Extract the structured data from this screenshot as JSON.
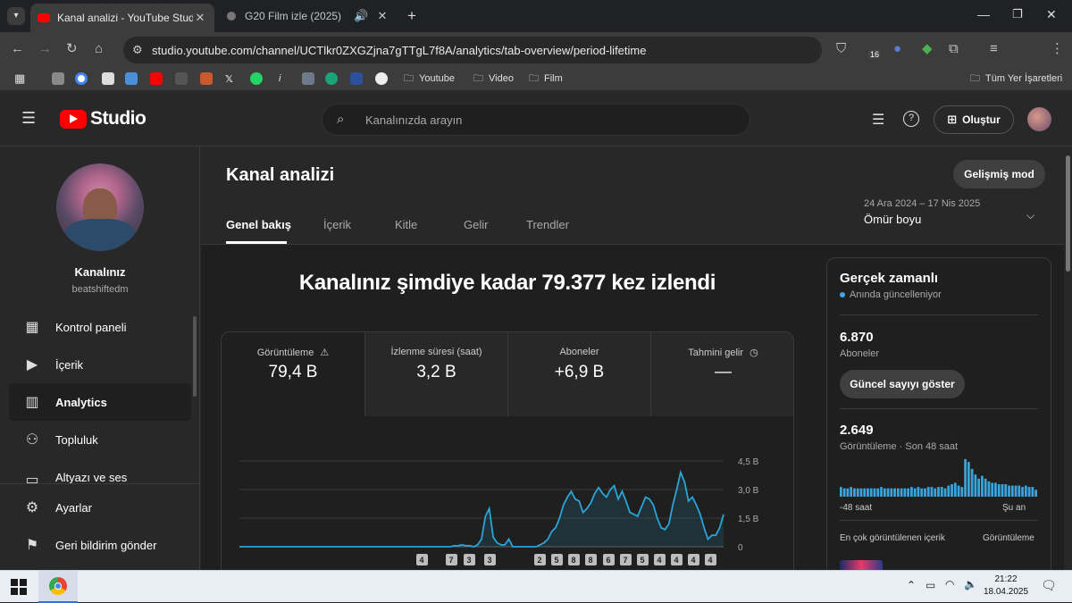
{
  "browser": {
    "tabs": [
      {
        "title": "Kanal analizi - YouTube Studio"
      },
      {
        "title": "G20 Film izle (2025)"
      }
    ],
    "url": "studio.youtube.com/channel/UCTlkr0ZXGZjna7gTTgL7f8A/analytics/tab-overview/period-lifetime",
    "bookmarks": [
      "Youtube",
      "Video",
      "Film"
    ],
    "all_bookmarks": "Tüm Yer İşaretleri",
    "extension_badge": "16"
  },
  "header": {
    "logo": "Studio",
    "search_placeholder": "Kanalınızda arayın",
    "create_label": "Oluştur"
  },
  "sidebar": {
    "channel_name": "Kanalınız",
    "channel_handle": "beatshiftedm",
    "items": [
      {
        "label": "Kontrol paneli",
        "icon": "dashboard-icon"
      },
      {
        "label": "İçerik",
        "icon": "content-icon"
      },
      {
        "label": "Analytics",
        "icon": "analytics-icon"
      },
      {
        "label": "Topluluk",
        "icon": "community-icon"
      },
      {
        "label": "Altyazı ve ses",
        "icon": "subtitles-icon"
      }
    ],
    "settings_label": "Ayarlar",
    "feedback_label": "Geri bildirim gönder"
  },
  "main": {
    "title": "Kanal analizi",
    "advanced_mode": "Gelişmiş mod",
    "tabs": [
      "Genel bakış",
      "İçerik",
      "Kitle",
      "Gelir",
      "Trendler"
    ],
    "date_range": "24 Ara 2024 – 17 Nis 2025",
    "period": "Ömür boyu",
    "headline": "Kanalınız şimdiye kadar 79.377 kez izlendi",
    "stats": [
      {
        "label": "Görüntüleme",
        "value": "79,4 B"
      },
      {
        "label": "İzlenme süresi (saat)",
        "value": "3,2 B"
      },
      {
        "label": "Aboneler",
        "value": "+6,9 B"
      },
      {
        "label": "Tahmini gelir",
        "value": "—"
      }
    ],
    "video_markers": [
      "4",
      "7",
      "3",
      "3",
      "2",
      "5",
      "8",
      "8",
      "6",
      "7",
      "5",
      "4",
      "4",
      "4",
      "4"
    ]
  },
  "chart_data": {
    "type": "area",
    "series": [
      {
        "values": [
          0,
          0,
          0,
          0,
          0,
          0,
          0,
          0,
          0,
          0,
          0,
          0,
          0,
          0,
          0,
          0,
          0,
          0,
          0,
          0,
          0,
          0,
          0,
          0,
          0,
          0,
          0,
          0,
          0,
          0,
          0,
          0,
          0,
          0,
          0,
          0,
          0,
          0,
          0,
          0,
          0,
          0,
          0,
          0,
          0,
          0,
          0,
          0,
          0,
          0,
          0,
          0,
          0,
          0,
          0,
          0.05,
          0.05,
          0.1,
          0.05,
          0.05,
          0,
          0.1,
          0.4,
          1.6,
          2.0,
          0.5,
          0.2,
          0.1,
          0.1,
          0.4,
          0,
          0,
          0,
          0,
          0,
          0,
          0,
          0.1,
          0.2,
          0.4,
          0.8,
          1.0,
          1.5,
          2.2,
          2.6,
          2.9,
          2.5,
          2.4,
          1.8,
          2.0,
          2.3,
          2.8,
          3.1,
          2.8,
          2.6,
          3.0,
          3.2,
          2.5,
          2.9,
          2.4,
          1.8,
          1.7,
          1.6,
          2.1,
          2.6,
          2.5,
          2.2,
          1.5,
          1.0,
          0.9,
          1.2,
          2.2,
          3.0,
          3.9,
          3.4,
          2.4,
          2.6,
          2.2,
          1.7,
          1.0,
          0.4,
          0.6,
          0.6,
          1.0,
          1.7
        ]
      }
    ],
    "y_ticks": [
      "4,5 B",
      "3,0 B",
      "1,5 B",
      "0"
    ],
    "ylim": [
      0,
      4.5
    ],
    "grid": true
  },
  "realtime": {
    "title": "Gerçek zamanlı",
    "subtitle": "Anında güncelleniyor",
    "subs_value": "6.870",
    "subs_label": "Aboneler",
    "show_count_btn": "Güncel sayıyı göster",
    "views_value": "2.649",
    "views_label": "Görüntüleme · Son 48 saat",
    "axis_left": "-48 saat",
    "axis_right": "Şu an",
    "top_content_label": "En çok görüntülenen içerik",
    "top_content_metric": "Görüntüleme",
    "bars": [
      7,
      6,
      6,
      7,
      6,
      6,
      6,
      6,
      6,
      6,
      6,
      6,
      7,
      6,
      6,
      6,
      6,
      6,
      6,
      6,
      6,
      7,
      6,
      7,
      6,
      6,
      7,
      7,
      6,
      7,
      7,
      6,
      8,
      9,
      10,
      8,
      7,
      27,
      25,
      20,
      16,
      13,
      15,
      13,
      11,
      10,
      10,
      9,
      9,
      9,
      8,
      8,
      8,
      8,
      7,
      8,
      7,
      7,
      5
    ]
  },
  "taskbar": {
    "time": "21:22",
    "date": "18.04.2025"
  },
  "colors": {
    "accent": "#3ea6ff",
    "yt_red": "#ff0000",
    "chart_line": "#2aa5d8"
  }
}
